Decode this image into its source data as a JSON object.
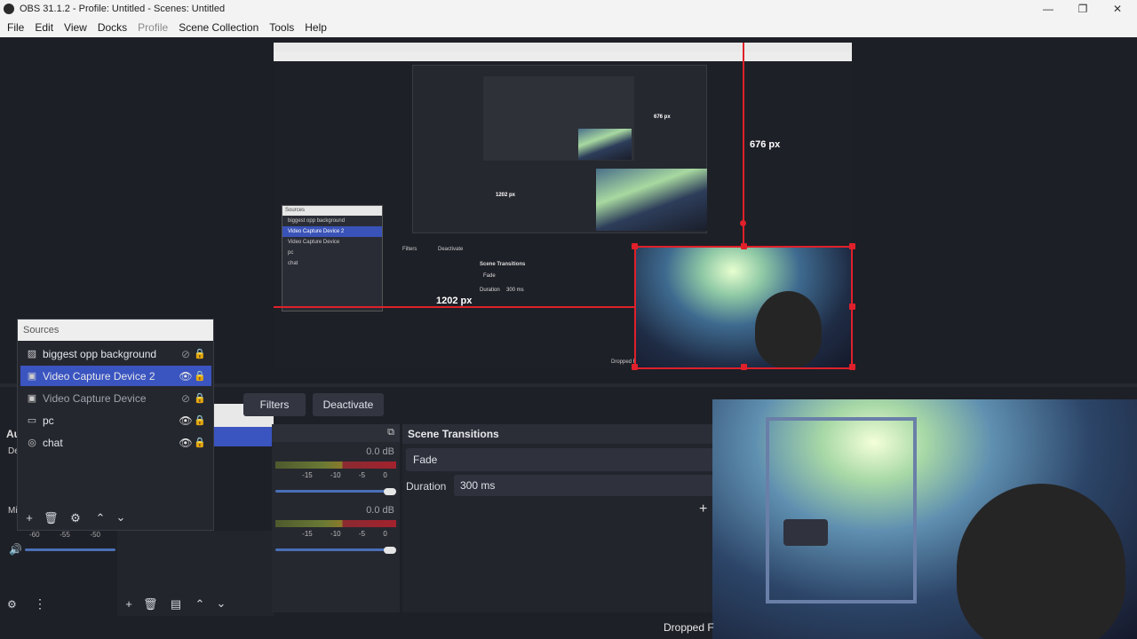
{
  "window": {
    "title": "OBS 31.1.2 - Profile: Untitled - Scenes: Untitled",
    "minimize": "—",
    "maximize": "❐",
    "close": "✕"
  },
  "menu": {
    "file": "File",
    "edit": "Edit",
    "view": "View",
    "docks": "Docks",
    "profile": "Profile",
    "scene_collection": "Scene Collection",
    "tools": "Tools",
    "help": "Help"
  },
  "preview": {
    "measure_vertical": "676 px",
    "measure_horizontal": "1202 px",
    "nested_measure_vertical": "676 px",
    "nested_measure_horizontal": "1202 px",
    "dropped_frames_nested": "Dropped F",
    "nested_filters": "Filters",
    "nested_deactivate": "Deactivate",
    "nested_scene_transitions": "Scene Transitions",
    "nested_fade": "Fade",
    "nested_duration_label": "Duration",
    "nested_duration_value": "300 ms",
    "nested_sources_title": "Sources",
    "nested_sources": [
      "biggest opp background",
      "Video Capture Device 2",
      "Video Capture Device",
      "pc",
      "chat"
    ]
  },
  "sources": {
    "title": "Sources",
    "items": [
      {
        "name": "biggest opp background",
        "icon": "image-icon",
        "visible": false,
        "selected": false
      },
      {
        "name": "Video Capture Device 2",
        "icon": "camera-icon",
        "visible": true,
        "selected": true
      },
      {
        "name": "Video Capture Device",
        "icon": "camera-icon",
        "visible": false,
        "selected": false
      },
      {
        "name": "pc",
        "icon": "monitor-icon",
        "visible": true,
        "selected": false
      },
      {
        "name": "chat",
        "icon": "browser-icon",
        "visible": true,
        "selected": false
      }
    ]
  },
  "controls": {
    "filters": "Filters",
    "deactivate": "Deactivate"
  },
  "mixer": {
    "track1_db": "0.0 dB",
    "track2_db": "0.0 dB",
    "scale": [
      "-15",
      "-10",
      "-5",
      "0"
    ],
    "left_scale": [
      "-60",
      "-55",
      "-50"
    ],
    "track1_volume": 1.0,
    "track2_volume": 1.0
  },
  "transitions": {
    "title": "Scene Transitions",
    "selected": "Fade",
    "duration_label": "Duration",
    "duration_value": "300 ms",
    "add": "+"
  },
  "status": {
    "dropped_frames": "Dropped F"
  },
  "partial_labels": {
    "audio": "Au",
    "de": "De",
    "mi": "Mi"
  }
}
